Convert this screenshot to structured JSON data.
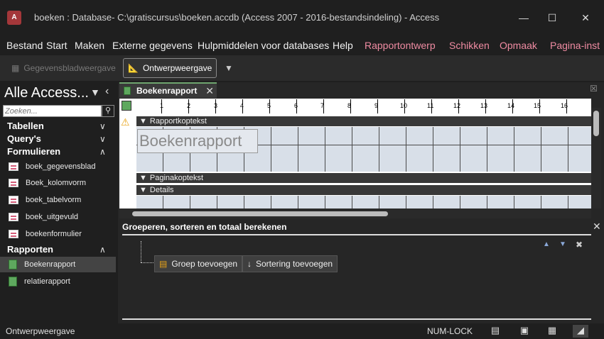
{
  "window": {
    "title": "boeken : Database- C:\\gratiscursus\\boeken.accdb (Access 2007 - 2016-bestandsindeling)  -  Access",
    "logo": "A"
  },
  "menu": {
    "items": [
      "Bestand",
      "Start",
      "Maken",
      "Externe gegevens",
      "Hulpmiddelen voor databases",
      "Help"
    ],
    "context": [
      "Rapportontwerp",
      "Schikken",
      "Opmaak",
      "Pagina-inst"
    ]
  },
  "ribbon": {
    "datasheet": "Gegevensbladweergave",
    "design": "Ontwerpweergave"
  },
  "nav": {
    "title": "Alle Access...",
    "search_placeholder": "Zoeken...",
    "groups": {
      "tables": "Tabellen",
      "queries": "Query's",
      "forms": "Formulieren",
      "reports": "Rapporten"
    },
    "forms": [
      "boek_gegevensblad",
      "Boek_kolomvorm",
      "boek_tabelvorm",
      "boek_uitgevuld",
      "boekenformulier"
    ],
    "reports": [
      "Boekenrapport",
      "relatierapport"
    ]
  },
  "doc": {
    "tab": "Boekenrapport",
    "sections": {
      "report_header": "Rapportkoptekst",
      "page_header": "Paginakoptekst",
      "details": "Details"
    },
    "title_control": "Boekenrapport",
    "ruler": [
      "1",
      "2",
      "3",
      "4",
      "5",
      "6",
      "7",
      "8",
      "9",
      "10",
      "11",
      "12",
      "13",
      "14",
      "15",
      "16"
    ]
  },
  "grouping": {
    "title": "Groeperen, sorteren en totaal berekenen",
    "add_group": "Groep toevoegen",
    "add_sort": "Sortering toevoegen"
  },
  "status": {
    "left": "Ontwerpweergave",
    "numlock": "NUM-LOCK"
  }
}
